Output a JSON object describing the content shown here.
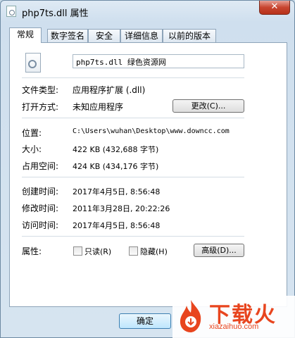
{
  "window": {
    "title": "php7ts.dll 属性",
    "close_glyph": "✕"
  },
  "tabs": [
    {
      "label": "常规",
      "active": true
    },
    {
      "label": "数字签名"
    },
    {
      "label": "安全"
    },
    {
      "label": "详细信息"
    },
    {
      "label": "以前的版本"
    }
  ],
  "general": {
    "file_name": "php7ts.dll 绿色资源网",
    "file_type_label": "文件类型:",
    "file_type_value": "应用程序扩展 (.dll)",
    "open_with_label": "打开方式:",
    "open_with_value": "未知应用程序",
    "change_button": "更改(C)...",
    "location_label": "位置:",
    "location_value": "C:\\Users\\wuhan\\Desktop\\www.downcc.com",
    "size_label": "大小:",
    "size_value": "422 KB (432,688 字节)",
    "disk_size_label": "占用空间:",
    "disk_size_value": "424 KB (434,176 字节)",
    "created_label": "创建时间:",
    "created_value": "2017年4月5日, 8:56:48",
    "modified_label": "修改时间:",
    "modified_value": "2011年3月28日, 20:22:26",
    "accessed_label": "访问时间:",
    "accessed_value": "2017年4月5日, 8:56:48",
    "attributes_label": "属性:",
    "readonly_label": "只读(R)",
    "hidden_label": "隐藏(H)",
    "advanced_button": "高级(D)..."
  },
  "footer": {
    "ok_button": "确定"
  },
  "watermark": {
    "text": "下载火",
    "url": "xiazaihuo.com"
  }
}
